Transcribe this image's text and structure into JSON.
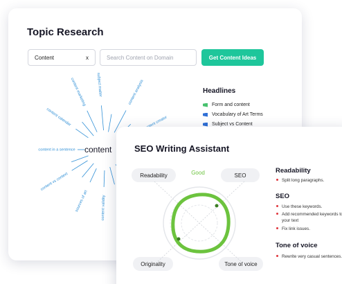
{
  "topic_research": {
    "title": "Topic Research",
    "content_input": {
      "value": "Content",
      "clear_label": "x"
    },
    "search_input": {
      "placeholder": "Search Content on Domain"
    },
    "get_ideas_button": "Get Content Ideas",
    "mindmap": {
      "center": "content",
      "words": [
        "content marketing",
        "subject matter",
        "content analysis",
        "content creator",
        "content calendar",
        "content in a sentence",
        "content vs context",
        "sources of art",
        "content validity"
      ]
    },
    "headlines": {
      "title": "Headlines",
      "items": [
        "Form and content",
        "Vocabulary of Art Terms",
        "Subject vs Content"
      ]
    }
  },
  "seo_writing_assistant": {
    "title": "SEO Writing Assistant",
    "gauge": {
      "readability": "Readability",
      "seo": "SEO",
      "originality": "Originality",
      "tone_of_voice": "Tone of voice",
      "score_label": "Good"
    },
    "sections": [
      {
        "heading": "Readability",
        "items": [
          "Split long paragraphs."
        ]
      },
      {
        "heading": "SEO",
        "items": [
          "Use these keywords.",
          "Add recommended keywords to your text",
          "Fix link issues."
        ]
      },
      {
        "heading": "Tone of voice",
        "items": [
          "Rewrite very casual sentences."
        ]
      }
    ]
  },
  "colors": {
    "accent_green": "#1ec69b",
    "mindmap_blue": "#2f8fd6",
    "score_green": "#6cc33e",
    "bullet_red": "#e0363d"
  }
}
